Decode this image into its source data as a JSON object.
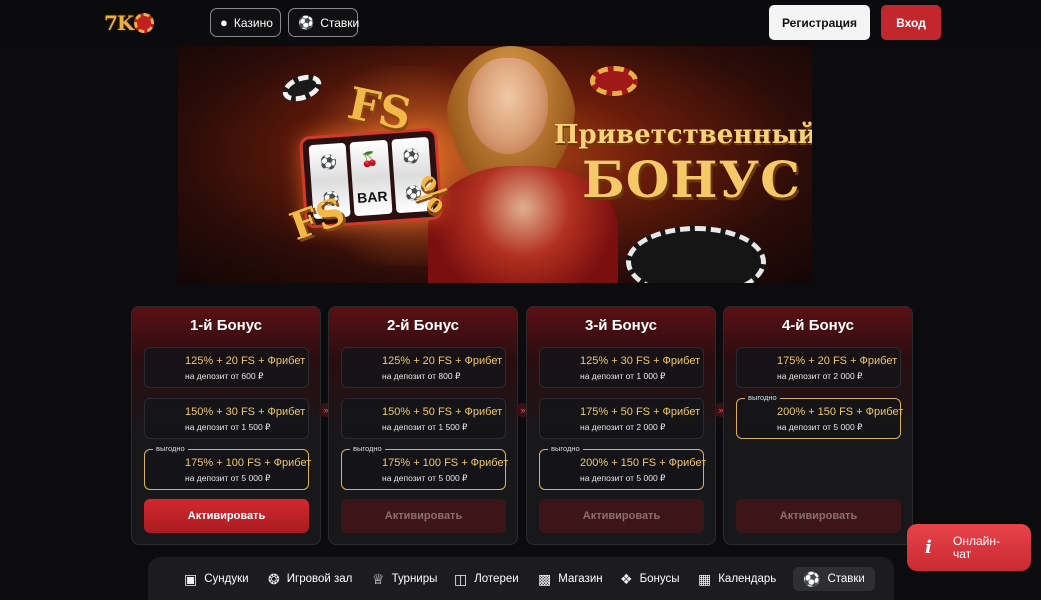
{
  "header": {
    "logo_text": "7K",
    "nav": [
      {
        "label": "Казино",
        "icon": "casino-chip-icon"
      },
      {
        "label": "Ставки",
        "icon": "soccer-ball-icon"
      }
    ],
    "register_label": "Регистрация",
    "login_label": "Вход"
  },
  "banner": {
    "title_line1": "Приветственный",
    "title_line2": "БОНУС",
    "slot_symbol": "BAR",
    "fs_text": "FS"
  },
  "bonuses": [
    {
      "title": "1-й Бонус",
      "tiers": [
        {
          "main": "125% + 20 FS + Фрибет",
          "sub": "на депозит от 600 ₽",
          "badge": ""
        },
        {
          "main": "150% + 30 FS + Фрибет",
          "sub": "на депозит от 1 500 ₽",
          "badge": ""
        },
        {
          "main": "175% + 100 FS + Фрибет",
          "sub": "на депозит от 5 000 ₽",
          "badge": "выгодно"
        }
      ],
      "button": "Активировать",
      "active": true
    },
    {
      "title": "2-й Бонус",
      "tiers": [
        {
          "main": "125% + 20 FS + Фрибет",
          "sub": "на депозит от 800 ₽",
          "badge": ""
        },
        {
          "main": "150% + 50 FS + Фрибет",
          "sub": "на депозит от 1 500 ₽",
          "badge": ""
        },
        {
          "main": "175% + 100 FS + Фрибет",
          "sub": "на депозит от 5 000 ₽",
          "badge": "выгодно"
        }
      ],
      "button": "Активировать",
      "active": false
    },
    {
      "title": "3-й Бонус",
      "tiers": [
        {
          "main": "125% + 30 FS + Фрибет",
          "sub": "на депозит от 1 000 ₽",
          "badge": ""
        },
        {
          "main": "175% + 50 FS + Фрибет",
          "sub": "на депозит от 2 000 ₽",
          "badge": ""
        },
        {
          "main": "200% + 150 FS + Фрибет",
          "sub": "на депозит от 5 000 ₽",
          "badge": "выгодно"
        }
      ],
      "button": "Активировать",
      "active": false
    },
    {
      "title": "4-й Бонус",
      "tiers": [
        {
          "main": "175% + 20 FS + Фрибет",
          "sub": "на депозит от 2 000 ₽",
          "badge": ""
        },
        {
          "main": "200% + 150 FS + Фрибет",
          "sub": "на депозит от 5 000 ₽",
          "badge": "выгодно"
        }
      ],
      "button": "Активировать",
      "active": false
    }
  ],
  "bottom_nav": [
    {
      "label": "Сундуки",
      "icon": "chest-icon"
    },
    {
      "label": "Игровой зал",
      "icon": "chip-icon"
    },
    {
      "label": "Турниры",
      "icon": "trophy-icon"
    },
    {
      "label": "Лотереи",
      "icon": "ticket-icon"
    },
    {
      "label": "Магазин",
      "icon": "shop-bag-icon"
    },
    {
      "label": "Бонусы",
      "icon": "gift-icon"
    },
    {
      "label": "Календарь",
      "icon": "calendar-icon"
    },
    {
      "label": "Ставки",
      "icon": "soccer-ball-icon",
      "active": true
    }
  ],
  "chat": {
    "label_line1": "Онлайн-",
    "label_line2": "чат",
    "icon": "info-icon"
  },
  "colors": {
    "accent_red": "#c1272d",
    "gold": "#f0c86a",
    "background": "#0c0c0e"
  }
}
